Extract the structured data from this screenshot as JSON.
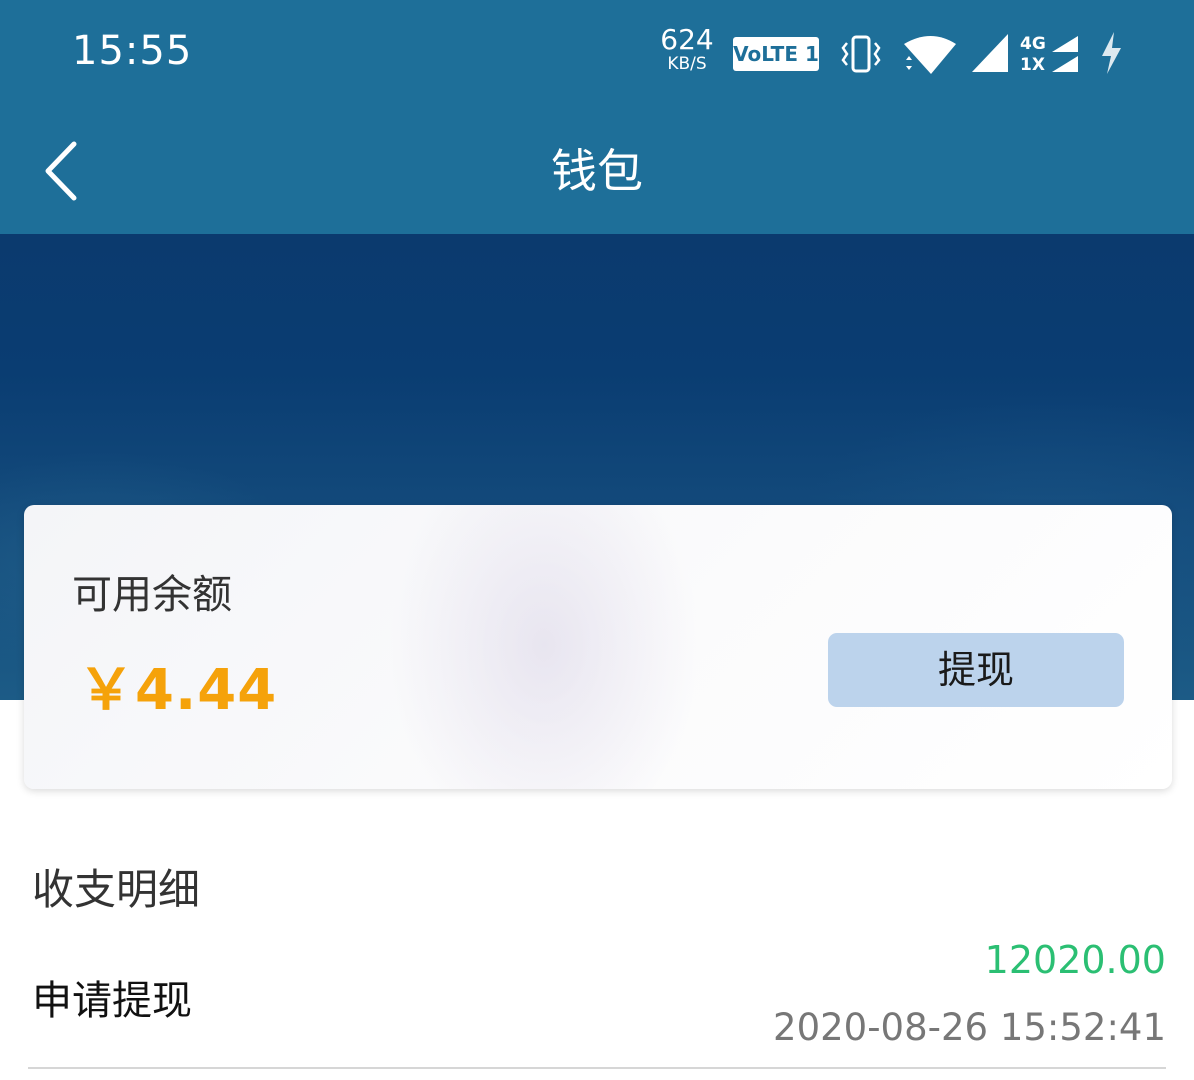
{
  "status_bar": {
    "time": "15:55",
    "net_speed_value": "624",
    "net_speed_unit": "KB/S",
    "volte_label": "VoLTE 1",
    "net_type_top": "4G",
    "net_type_bottom": "1X",
    "icons": [
      "vibrate-icon",
      "wifi-icon",
      "cell-signal-icon",
      "cell-signal-secondary-icon",
      "charging-icon"
    ]
  },
  "nav": {
    "title": "钱包",
    "back_icon": "chevron-left-icon"
  },
  "wallet": {
    "balance_label": "可用余额",
    "balance_amount": "￥4.44",
    "withdraw_label": "提现",
    "amount_color": "#f5a20a"
  },
  "details": {
    "section_title": "收支明细",
    "transactions": [
      {
        "name": "申请提现",
        "amount": "12020.00",
        "time": "2020-08-26 15:52:41",
        "amount_color": "#2bbf73"
      }
    ]
  },
  "colors": {
    "header_bg": "#1e6f99",
    "button_bg": "#bcd3ec"
  }
}
